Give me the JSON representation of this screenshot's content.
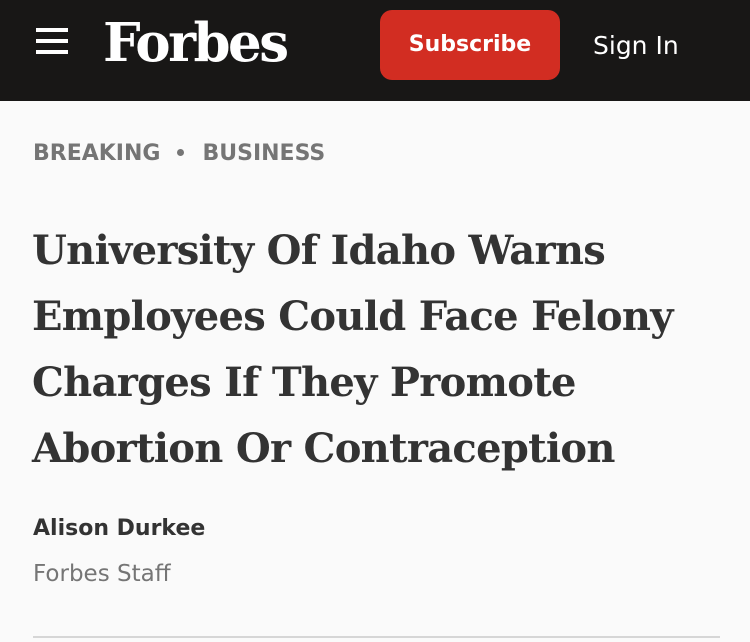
{
  "header": {
    "menu_icon": "hamburger-menu-icon",
    "logo_text": "Forbes",
    "subscribe_label": "Subscribe",
    "signin_label": "Sign In",
    "background_color": "#181716",
    "accent_color": "#d22d22"
  },
  "article": {
    "breadcrumb": [
      "BREAKING",
      "BUSINESS"
    ],
    "headline": "University Of Idaho Warns Employees Could Face Felony Charges If They Promote Abortion Or Contraception",
    "author_name": "Alison Durkee",
    "author_role": "Forbes Staff"
  }
}
